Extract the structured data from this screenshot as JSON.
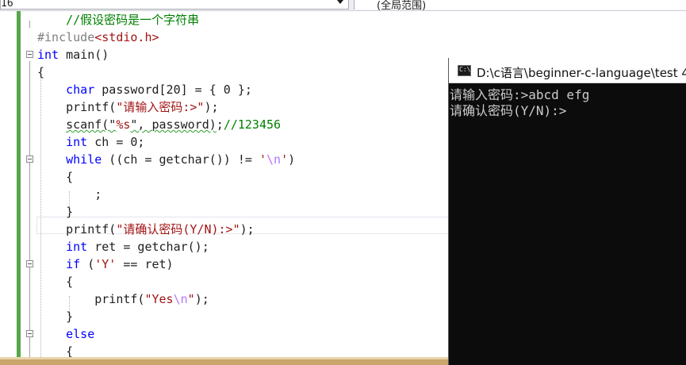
{
  "toolbar": {
    "line_number_field": "16",
    "scope_field": "(全局范围)"
  },
  "editor": {
    "lines": [
      {
        "id": "l1",
        "parts": [
          {
            "t": "    "
          },
          {
            "t": "//假设密码是一个字符串",
            "c": "cm"
          }
        ]
      },
      {
        "id": "l2",
        "parts": [
          {
            "t": "#include",
            "c": "pp"
          },
          {
            "t": "<stdio.h>",
            "c": "inc"
          }
        ]
      },
      {
        "id": "l3",
        "parts": [
          {
            "t": "int",
            "c": "kw"
          },
          {
            "t": " main()"
          }
        ]
      },
      {
        "id": "l4",
        "parts": [
          {
            "t": "{"
          }
        ]
      },
      {
        "id": "l5",
        "parts": [
          {
            "t": "    "
          },
          {
            "t": "char",
            "c": "kw"
          },
          {
            "t": " password[20] = { 0 };"
          }
        ]
      },
      {
        "id": "l6",
        "parts": [
          {
            "t": "    printf("
          },
          {
            "t": "\"请输入密码:>\"",
            "c": "str"
          },
          {
            "t": ");"
          }
        ]
      },
      {
        "id": "l7",
        "parts": [
          {
            "t": "    "
          },
          {
            "t": "scanf(\"",
            "c": "squig"
          },
          {
            "t": "%s",
            "c": "str"
          },
          {
            "t": "\", password)",
            "c": "squig"
          },
          {
            "t": ";"
          },
          {
            "t": "//123456",
            "c": "cm"
          }
        ]
      },
      {
        "id": "l8",
        "parts": [
          {
            "t": "    "
          },
          {
            "t": "int",
            "c": "kw"
          },
          {
            "t": " ch = 0;"
          }
        ]
      },
      {
        "id": "l9",
        "parts": [
          {
            "t": "    "
          },
          {
            "t": "while",
            "c": "kw"
          },
          {
            "t": " ((ch = getchar()) != "
          },
          {
            "t": "'",
            "c": "str"
          },
          {
            "t": "\\n",
            "c": "esc"
          },
          {
            "t": "'",
            "c": "str"
          },
          {
            "t": ")"
          }
        ]
      },
      {
        "id": "l10",
        "parts": [
          {
            "t": "    {"
          }
        ]
      },
      {
        "id": "l11",
        "parts": [
          {
            "t": "        ;"
          }
        ]
      },
      {
        "id": "l12",
        "parts": [
          {
            "t": "    }"
          }
        ]
      },
      {
        "id": "l13",
        "parts": [
          {
            "t": "    printf("
          },
          {
            "t": "\"请确认密码(Y/N):>\"",
            "c": "str"
          },
          {
            "t": ");"
          }
        ]
      },
      {
        "id": "l14",
        "parts": [
          {
            "t": "    "
          },
          {
            "t": "int",
            "c": "kw"
          },
          {
            "t": " ret = getchar();"
          }
        ]
      },
      {
        "id": "l15",
        "parts": [
          {
            "t": "    "
          },
          {
            "t": "if",
            "c": "kw"
          },
          {
            "t": " ("
          },
          {
            "t": "'Y'",
            "c": "str"
          },
          {
            "t": " == ret)"
          }
        ]
      },
      {
        "id": "l16",
        "parts": [
          {
            "t": "    {"
          }
        ]
      },
      {
        "id": "l17",
        "parts": [
          {
            "t": "        printf("
          },
          {
            "t": "\"Yes",
            "c": "str"
          },
          {
            "t": "\\n",
            "c": "esc"
          },
          {
            "t": "\"",
            "c": "str"
          },
          {
            "t": ");"
          }
        ]
      },
      {
        "id": "l18",
        "parts": [
          {
            "t": "    }"
          }
        ]
      },
      {
        "id": "l19",
        "parts": [
          {
            "t": "    "
          },
          {
            "t": "else",
            "c": "kw"
          }
        ]
      },
      {
        "id": "l20",
        "parts": [
          {
            "t": "    {"
          }
        ]
      }
    ]
  },
  "console": {
    "title": "D:\\c语言\\beginner-c-language\\test 4",
    "icon_label": "C:\\",
    "output": [
      "请输入密码:>abcd efg",
      "请确认密码(Y/N):>"
    ]
  },
  "colors": {
    "keyword": "#0000ff",
    "comment": "#008000",
    "string": "#a31515",
    "escape": "#b776fb",
    "gutter_change": "#57a64a",
    "console_bg": "#0c0c0c"
  }
}
